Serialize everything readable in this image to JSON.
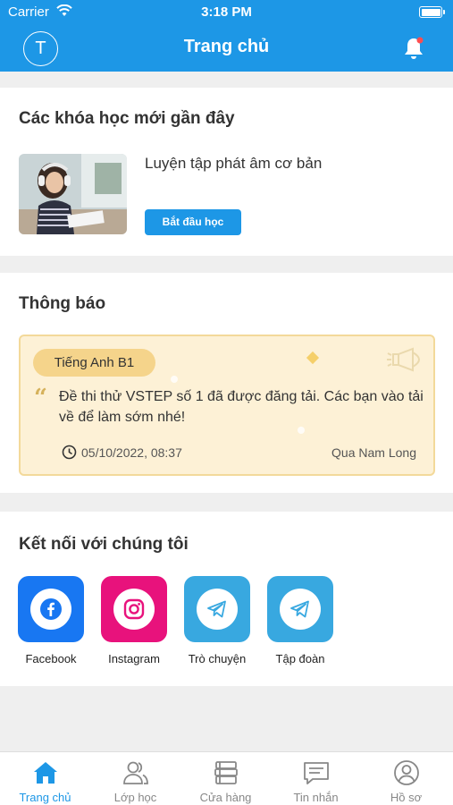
{
  "status_bar": {
    "carrier": "Carrier",
    "time": "3:18 PM"
  },
  "header": {
    "avatar_initial": "T",
    "title": "Trang chủ"
  },
  "recent_courses": {
    "title": "Các khóa học mới gần đây",
    "course": {
      "name": "Luyện tập phát âm cơ bản",
      "button": "Bắt đầu học"
    }
  },
  "notifications": {
    "title": "Thông báo",
    "item": {
      "tag": "Tiếng Anh B1",
      "message": "Đề thi thử VSTEP số 1 đã được đăng tải. Các bạn vào tải về để làm sớm nhé!",
      "datetime": "05/10/2022, 08:37",
      "author": "Qua Nam Long"
    }
  },
  "connect": {
    "title": "Kết nối với chúng tôi",
    "items": [
      {
        "label": "Facebook",
        "icon": "facebook-icon",
        "color": "#1877f2"
      },
      {
        "label": "Instagram",
        "icon": "instagram-icon",
        "color": "#e8127c"
      },
      {
        "label": "Trò chuyện",
        "icon": "telegram-icon",
        "color": "#38a8e0"
      },
      {
        "label": "Tập đoàn",
        "icon": "telegram-icon",
        "color": "#38a8e0"
      }
    ]
  },
  "tabbar": {
    "items": [
      {
        "label": "Trang chủ",
        "icon": "home-icon",
        "active": true
      },
      {
        "label": "Lớp học",
        "icon": "users-icon",
        "active": false
      },
      {
        "label": "Cửa hàng",
        "icon": "books-icon",
        "active": false
      },
      {
        "label": "Tin nhắn",
        "icon": "message-icon",
        "active": false
      },
      {
        "label": "Hồ sơ",
        "icon": "profile-icon",
        "active": false
      }
    ]
  },
  "colors": {
    "primary": "#1d97e6",
    "notice_bg": "#fdf1d6",
    "tag_bg": "#f5d48b"
  }
}
